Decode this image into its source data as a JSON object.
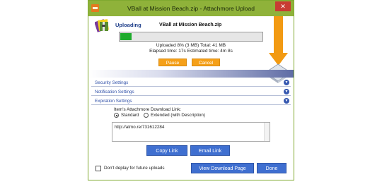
{
  "window": {
    "title": "VBall at Mission Beach.zip - Attachmore Upload",
    "close_glyph": "✕",
    "accent_color": "#8fb23a"
  },
  "upload": {
    "status": "Uploading",
    "file_name": "VBall at Mission Beach.zip",
    "progress_percent": 8,
    "stats_line": "Uploaded 8% (3 MB) Total: 41 MB",
    "time_line": "Elapsed time: 17s Estimated time: 4m 8s",
    "pause_label": "Pause",
    "cancel_label": "Cancel"
  },
  "sections": [
    {
      "label": "Security Settings",
      "icon": "chevron-down-icon"
    },
    {
      "label": "Notification Settings",
      "icon": "chevron-down-icon"
    },
    {
      "label": "Expiration Settings",
      "icon": "chevron-down-icon"
    }
  ],
  "download_link": {
    "label": "Item's Attachmore Download Link:",
    "options": [
      "Standard",
      "Extended (with Description)"
    ],
    "selected": "Standard",
    "value": "http://atmo.re/731612284",
    "copy_label": "Copy Link",
    "email_label": "Email Link"
  },
  "footer": {
    "checkbox_label": "Don't deplay for future uploads",
    "checked": false,
    "view_label": "View Download Page",
    "done_label": "Done"
  }
}
